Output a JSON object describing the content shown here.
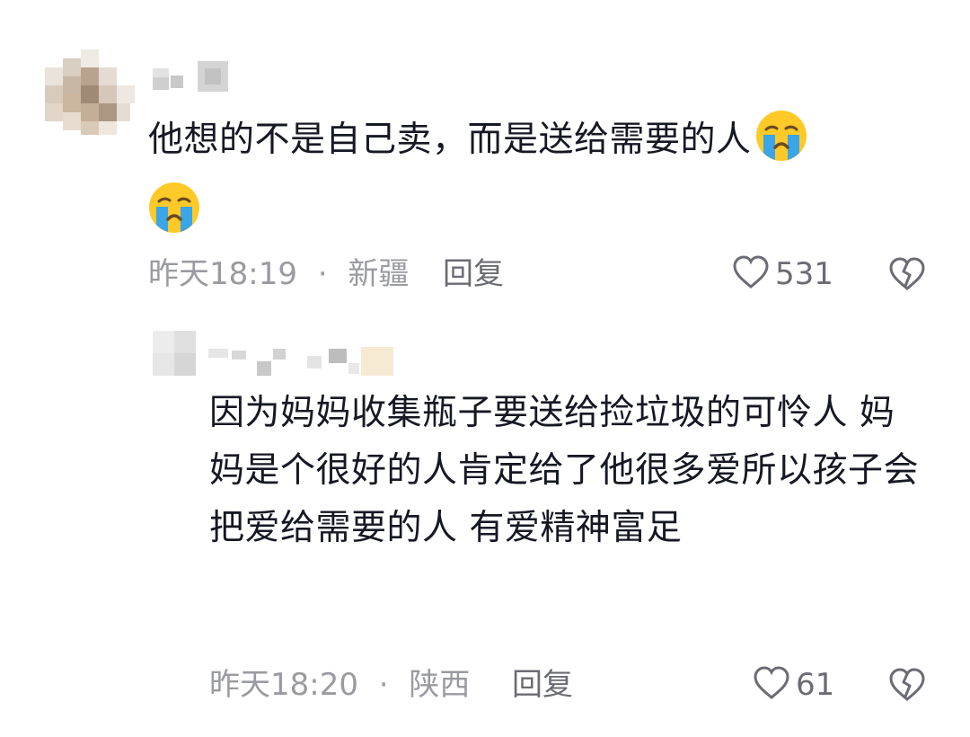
{
  "comments": [
    {
      "text": "他想的不是自己卖，而是送给需要的人",
      "emoji": "crying-face-icon",
      "time": "昨天18:19",
      "separator": "·",
      "location": "新疆",
      "reply_label": "回复",
      "likes": "531"
    }
  ],
  "reply": {
    "text": "因为妈妈收集瓶子要送给捡垃圾的可怜人 妈妈是个很好的人肯定给了他很多爱所以孩子会把爱给需要的人 有爱精神富足",
    "time": "昨天18:20",
    "separator": "·",
    "location": "陕西",
    "reply_label": "回复",
    "likes": "61"
  },
  "colors": {
    "meta_text": "#9a9ba1",
    "action_text": "#6b6c73",
    "body_text": "#161823"
  }
}
